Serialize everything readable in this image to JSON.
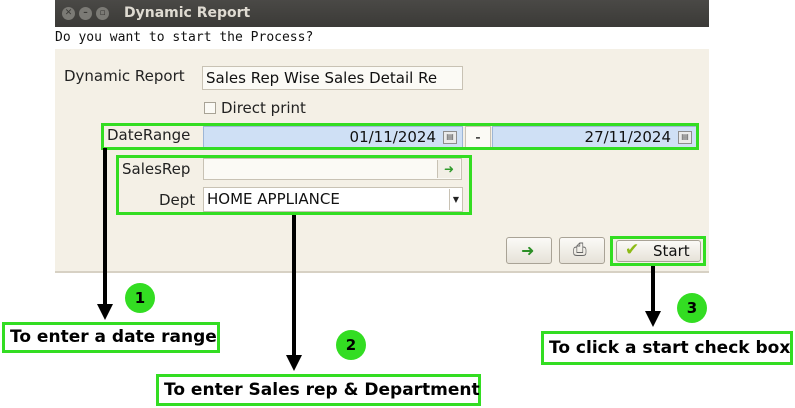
{
  "window": {
    "title": "Dynamic Report",
    "buttons": [
      "close",
      "minimize",
      "maximize"
    ]
  },
  "dialog": {
    "question": "Do you want to start the Process?",
    "report_label": "Dynamic Report",
    "report_value": "Sales Rep Wise Sales Detail Re",
    "direct_print_label": "Direct print",
    "date_range_label": "DateRange",
    "date_from": "01/11/2024",
    "date_separator": "-",
    "date_to": "27/11/2024",
    "salesrep_label": "SalesRep",
    "salesrep_value": "",
    "dept_label": "Dept",
    "dept_value": "HOME APPLIANCE",
    "start_label": "Start"
  },
  "annotations": {
    "step1_number": "1",
    "step1_text": "To enter a date range",
    "step2_number": "2",
    "step2_text": "To enter Sales rep & Department",
    "step3_number": "3",
    "step3_text": "To click a start check box"
  },
  "colors": {
    "highlight": "#33dd22",
    "titlebar": "#3b3a37",
    "dialog_bg": "#f4f0e6",
    "date_bg": "#cfe0f5"
  }
}
